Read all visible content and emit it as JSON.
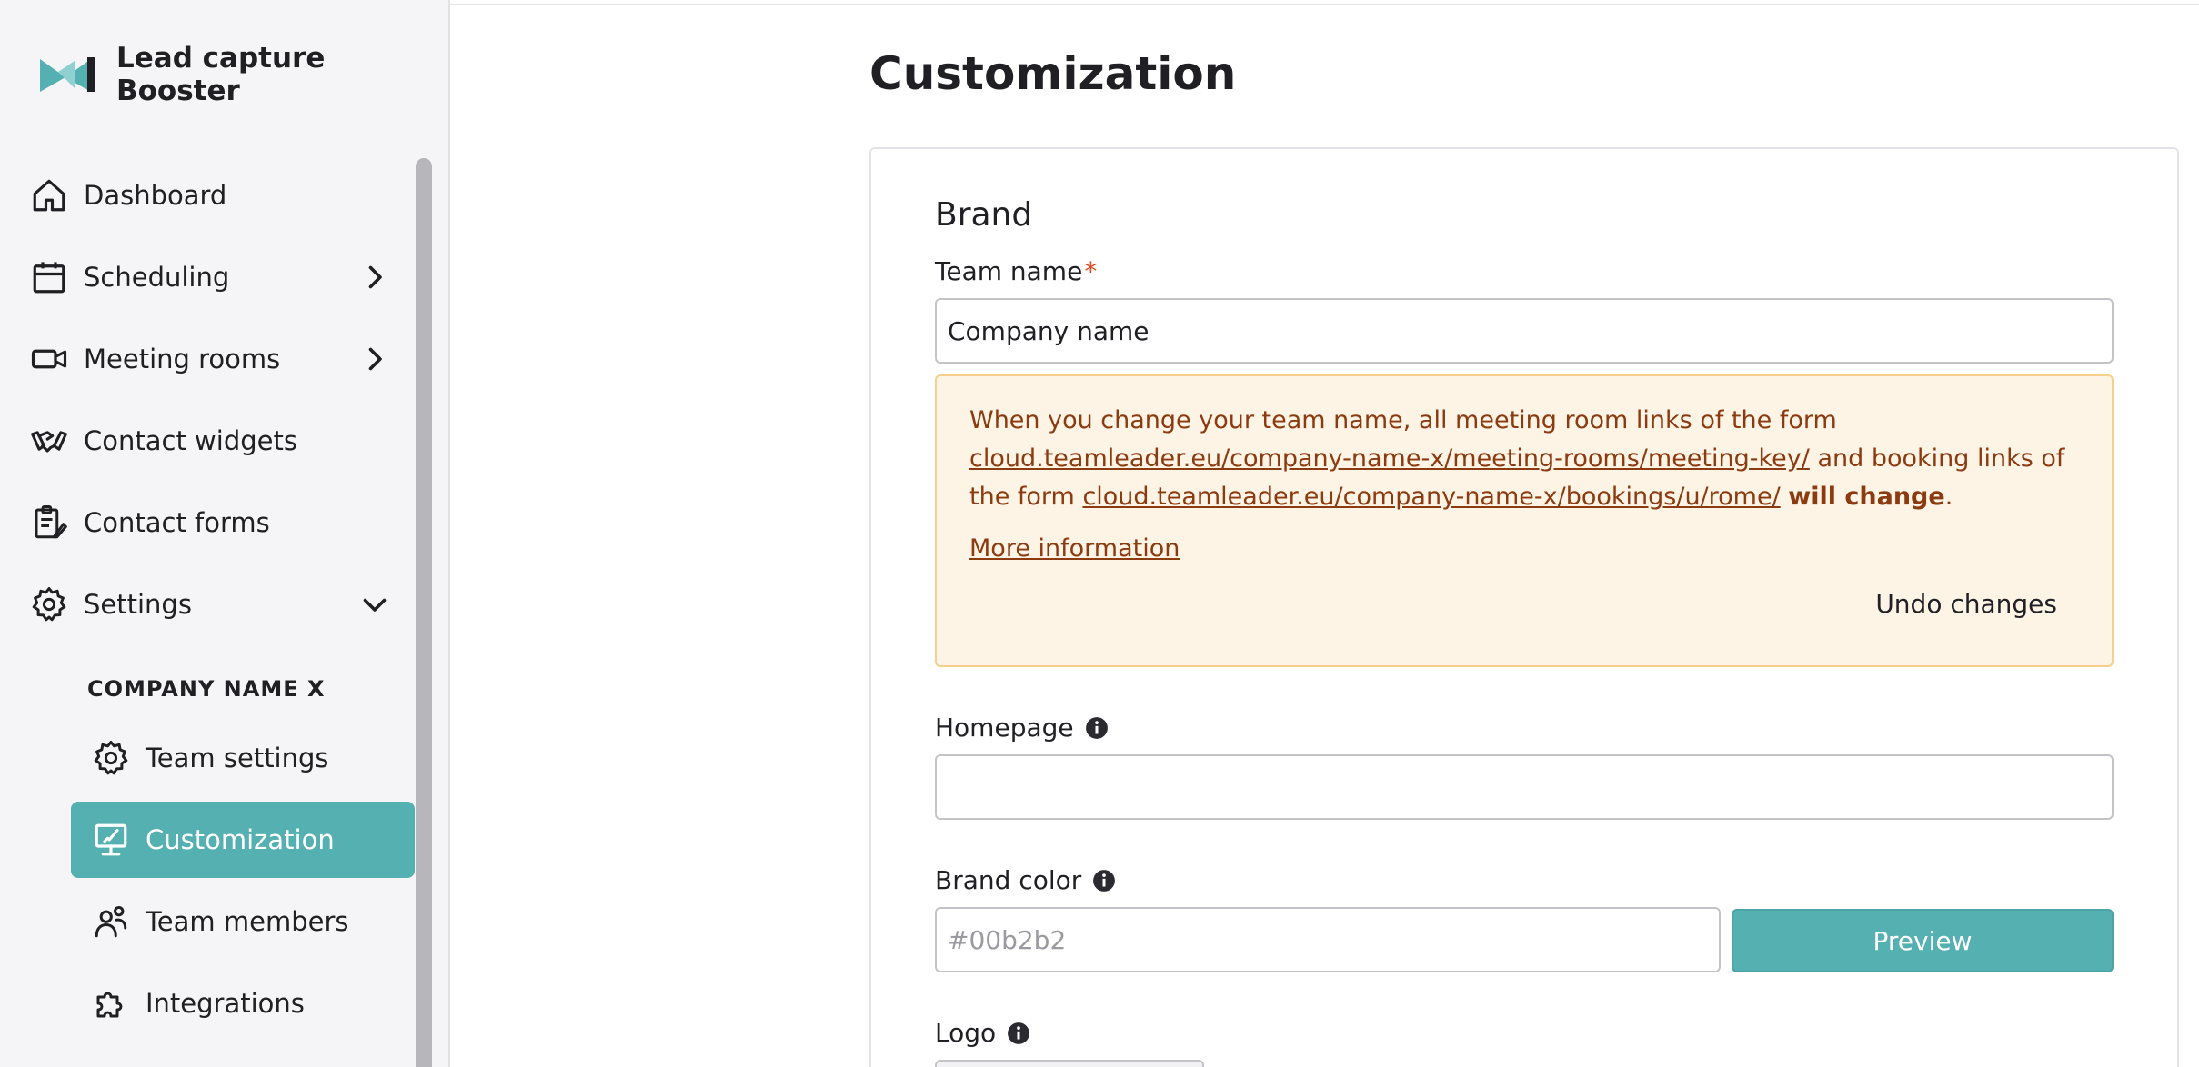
{
  "app": {
    "name_line1": "Lead capture",
    "name_line2": "Booster"
  },
  "sidebar": {
    "items": [
      {
        "label": "Dashboard",
        "icon": "home-icon"
      },
      {
        "label": "Scheduling",
        "icon": "calendar-icon",
        "chevron": "right"
      },
      {
        "label": "Meeting rooms",
        "icon": "video-camera-icon",
        "chevron": "right"
      },
      {
        "label": "Contact widgets",
        "icon": "handshake-icon"
      },
      {
        "label": "Contact forms",
        "icon": "clipboard-form-icon"
      },
      {
        "label": "Settings",
        "icon": "gear-icon",
        "chevron": "down"
      }
    ],
    "section_title": "COMPANY NAME X",
    "sub_items": [
      {
        "label": "Team settings",
        "icon": "gear-icon"
      },
      {
        "label": "Customization",
        "icon": "monitor-brush-icon",
        "active": true
      },
      {
        "label": "Team members",
        "icon": "users-icon"
      },
      {
        "label": "Integrations",
        "icon": "puzzle-icon"
      }
    ]
  },
  "main": {
    "page_title": "Customization",
    "card_title": "Brand",
    "team_name": {
      "label": "Team name",
      "required_mark": "*",
      "value": "Company name"
    },
    "warning": {
      "text_1": "When you change your team name, all meeting room links of the form ",
      "link_1": "cloud.teamleader.eu/company-name-x/meeting-rooms/meeting-key/",
      "text_2": " and booking links of the form ",
      "link_2": "cloud.teamleader.eu/company-name-x/bookings/u/rome/",
      "text_3": " ",
      "bold": "will change",
      "text_4": ".",
      "more_info": "More information",
      "undo": "Undo changes"
    },
    "homepage": {
      "label": "Homepage",
      "value": ""
    },
    "brand_color": {
      "label": "Brand color",
      "placeholder": "#00b2b2",
      "preview": "Preview"
    },
    "logo": {
      "label": "Logo"
    }
  },
  "colors": {
    "accent": "#54b0b1",
    "warning_bg": "#fdf4e6",
    "warning_border": "#f6d08c",
    "warning_text": "#8c3a10",
    "required": "#e14b1f"
  }
}
